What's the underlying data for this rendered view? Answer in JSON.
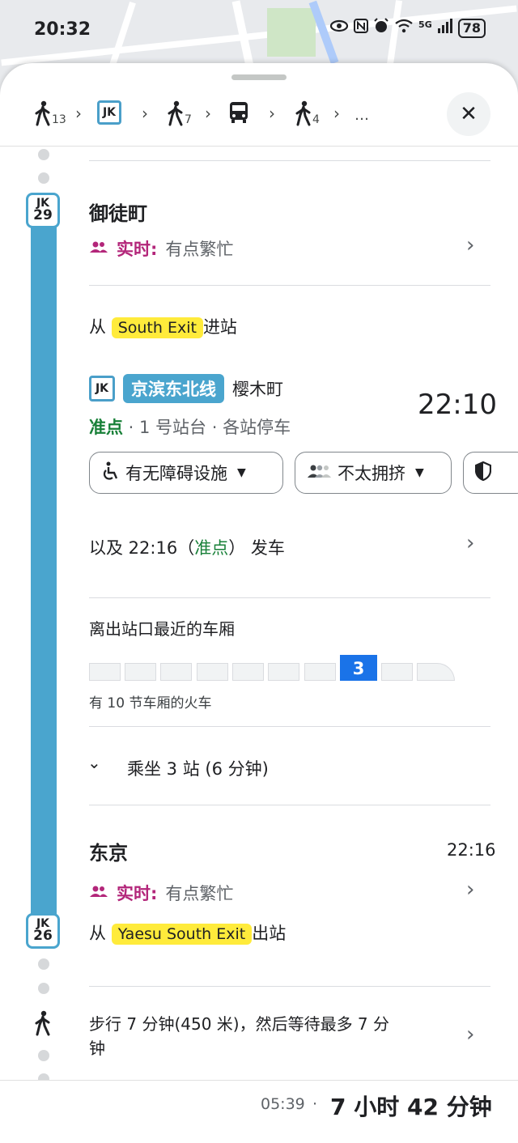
{
  "status_bar": {
    "time": "20:32",
    "network_label": "5G",
    "battery": "78"
  },
  "steps_bar": {
    "items": [
      {
        "type": "walk",
        "minutes": "13"
      },
      {
        "type": "line",
        "badge": "JK"
      },
      {
        "type": "walk",
        "minutes": "7"
      },
      {
        "type": "bus"
      },
      {
        "type": "walk",
        "minutes": "4"
      }
    ],
    "more": "…",
    "close_label": "✕"
  },
  "origin_station": {
    "badge_line": "JK",
    "badge_number": "29",
    "name": "御徒町",
    "realtime_label": "实时:",
    "realtime_value": "有点繁忙"
  },
  "entrance": {
    "prefix": "从",
    "exit_name": "South Exit",
    "suffix": "进站"
  },
  "train": {
    "badge": "JK",
    "line_name": "京滨东北线",
    "destination": "樱木町",
    "departure_time": "22:10",
    "status": "准点",
    "details": " · 1 号站台 · 各站停车",
    "accessibility_label": "有无障碍设施",
    "crowd_label": "不太拥挤",
    "next_prefix": "以及 22:16（",
    "next_status": "准点",
    "next_suffix": "） 发车"
  },
  "cars": {
    "title": "离出站口最近的车厢",
    "selected_car": "3",
    "caption": "有 10 节车厢的火车"
  },
  "ride": {
    "summary": "乘坐 3 站 (6 分钟)"
  },
  "destination_station": {
    "badge_line": "JK",
    "badge_number": "26",
    "name": "东京",
    "arrival_time": "22:16",
    "realtime_label": "实时:",
    "realtime_value": "有点繁忙",
    "exit_prefix": "从",
    "exit_name": "Yaesu South Exit",
    "exit_suffix": "出站"
  },
  "walk": {
    "line1": "步行 7 分钟(450 米)，然后等待最多 7 分",
    "line2": "钟"
  },
  "footer": {
    "arrival": "05:39",
    "separator": "·",
    "duration": "7 小时 42 分钟"
  },
  "colors": {
    "line_color": "#4aa5ce",
    "realtime_color": "#b3267a",
    "on_time_color": "#188038",
    "highlight": "#ffeb3b",
    "selected_car": "#1a73e8"
  }
}
